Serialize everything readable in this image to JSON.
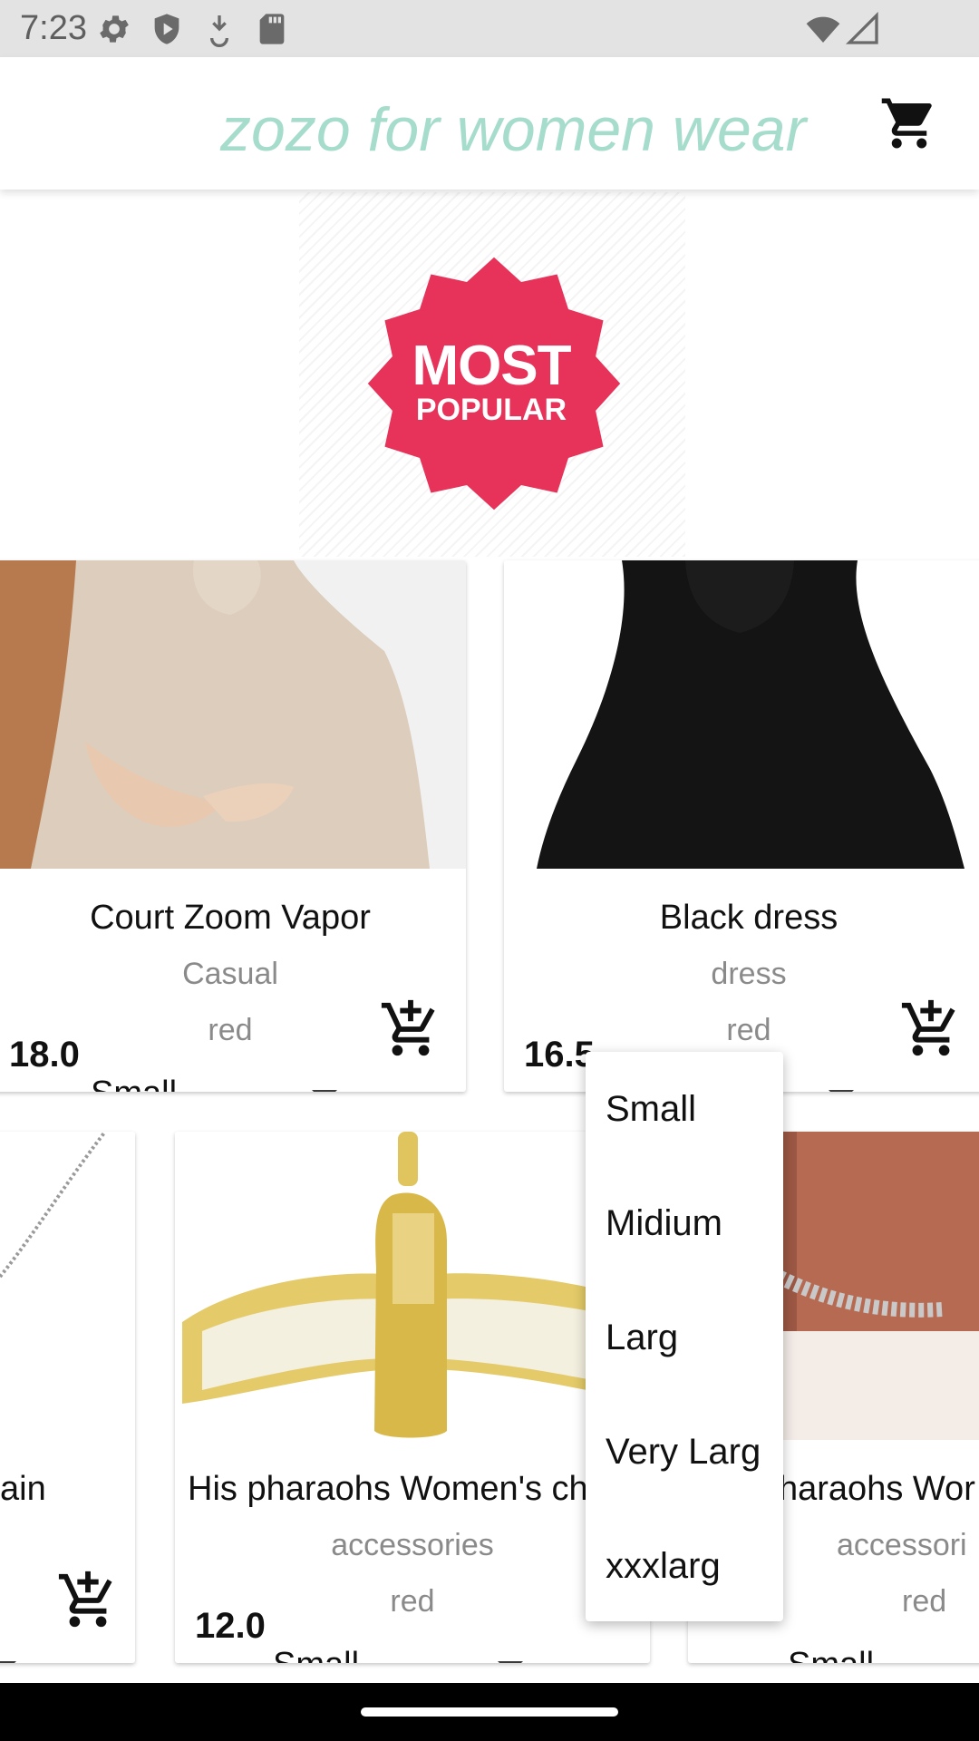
{
  "status_bar": {
    "time": "7:23",
    "left_icons": [
      "gear-icon",
      "shield-icon",
      "download-icon",
      "sd-card-icon"
    ],
    "right_icons": [
      "wifi-icon",
      "signal-icon"
    ]
  },
  "app_bar": {
    "title": "zozo for women wear",
    "title_color": "#a6dccb",
    "cart_icon": "cart-icon"
  },
  "banner": {
    "line1": "MOST",
    "line2": "POPULAR",
    "badge_color": "#e7325a"
  },
  "products_row1": [
    {
      "name": "Court Zoom Vapor",
      "category": "Casual",
      "color": "red",
      "price": "18.0",
      "size": "Small"
    },
    {
      "name": "Black dress",
      "category": "dress",
      "color": "red",
      "price": "16.5",
      "size": ""
    }
  ],
  "products_row2": [
    {
      "name": "ain",
      "category": "",
      "color": "",
      "price": "",
      "size": ""
    },
    {
      "name": "His pharaohs Women's ch",
      "category": "accessories",
      "color": "red",
      "price": "12.0",
      "size": "Small"
    },
    {
      "name": "haraohs Wor",
      "category": "accessori",
      "color": "red",
      "price": "",
      "size": "Small"
    }
  ],
  "size_dropdown": {
    "options": [
      "Small",
      "Midium",
      "Larg",
      "Very Larg",
      "xxxlarg"
    ]
  }
}
